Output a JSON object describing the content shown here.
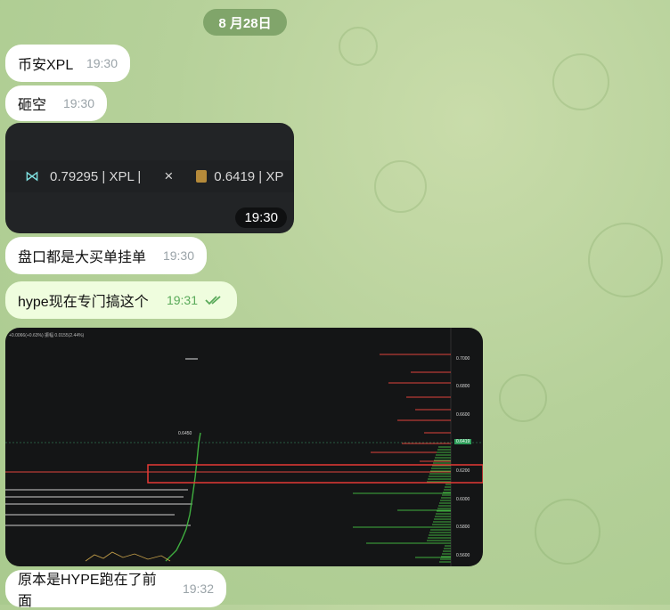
{
  "date_label": "8 月28日",
  "messages": [
    {
      "text": "币安XPL",
      "time": "19:30"
    },
    {
      "text": "砸空",
      "time": "19:30"
    },
    {
      "text": "盘口都是大买单挂单",
      "time": "19:30"
    },
    {
      "text": "hype现在专门搞这个",
      "time": "19:31"
    },
    {
      "text": "原本是HYPE跑在了前面",
      "time": "19:32"
    }
  ],
  "image1": {
    "ticker1": "0.79295 | XPL |",
    "close": "×",
    "ticker2": "0.6419 | XP",
    "time": "19:30"
  },
  "chart_image": {
    "header": "+0.0066(+0.63%)   振幅 0.0155(2.44%)",
    "high_label": "0.6450",
    "price_axis": [
      "0.7000",
      "0.6800",
      "0.6600",
      "0.6419",
      "0.6200",
      "0.6000",
      "0.5800",
      "0.5600"
    ],
    "current_price_badge": "0.6419",
    "colors": {
      "ask": "#e0443c",
      "bid": "#3fae3f",
      "highlight": "#e53935"
    }
  }
}
